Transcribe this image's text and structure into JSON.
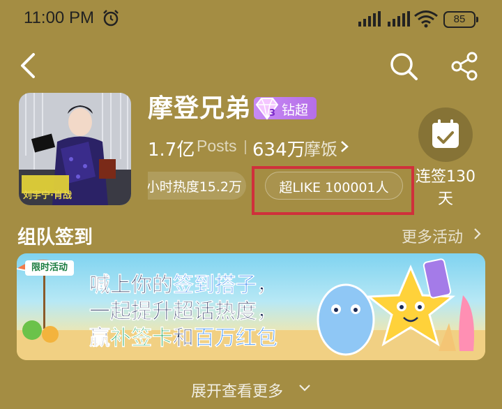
{
  "status_bar": {
    "time": "11:00 PM",
    "battery": "85",
    "icons": [
      "alarm-icon",
      "signal-icon",
      "signal-icon",
      "wifi-icon",
      "battery-icon"
    ]
  },
  "nav": {
    "icons": [
      "back-icon",
      "search-icon",
      "share-icon"
    ]
  },
  "profile": {
    "name": "摩登兄弟",
    "badge_level": "3",
    "badge_label": "钻超",
    "posts_count": "1.7亿",
    "posts_label": "Posts",
    "fans_count": "634万",
    "fans_label": "摩饭",
    "heat_label": "小时热度15.2万",
    "like_label": "超LIKE 100001人",
    "avatar_caption": "刘宇宁·肖战"
  },
  "checkin": {
    "label_line1": "连签130",
    "label_line2": "天"
  },
  "section": {
    "title": "组队签到",
    "more_label": "更多活动"
  },
  "banner": {
    "tag": "限时活动",
    "line1_a": "喊上你的",
    "line1_b": "签到搭子",
    "line1_c": "，",
    "line2": "一起提升超话热度，",
    "line3_a": "赢",
    "line3_b": "补签卡",
    "line3_c": "和",
    "line3_d": "百万红包"
  },
  "footer": {
    "expand_label": "展开查看更多"
  },
  "colors": {
    "background": "#a48d43",
    "badge": "#b56ee8",
    "highlight_box": "#d0303b",
    "banner_green": "#0ea052",
    "banner_blue": "#1e7ef0"
  }
}
